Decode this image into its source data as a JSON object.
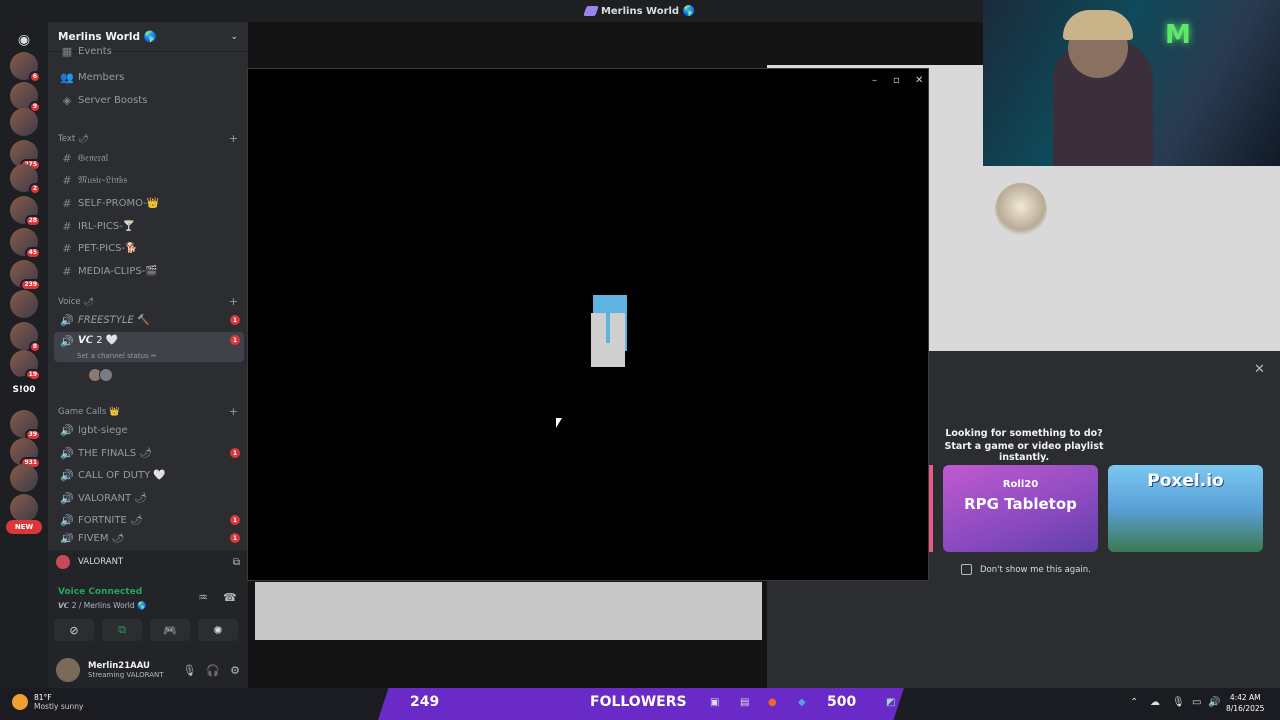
{
  "window": {
    "title": "Merlins World 🌎"
  },
  "servers": {
    "badges": [
      "6",
      "9",
      "",
      "275",
      "2",
      "28",
      "45",
      "239",
      "",
      "8",
      "19",
      "",
      "39",
      "931",
      "",
      ""
    ],
    "new_label": "NEW",
    "s100_label": "S!00"
  },
  "server": {
    "name": "Merlins World 🌎",
    "top_items": [
      {
        "icon": "calendar-icon",
        "label": "Events"
      },
      {
        "icon": "members-icon",
        "label": "Members"
      },
      {
        "icon": "boost-icon",
        "label": "Server Boosts"
      }
    ],
    "categories": {
      "text": "Text 🌶",
      "voice": "Voice 🌶",
      "game": "Game Calls 👑"
    },
    "text_channels": [
      "𝔊𝔢𝔫𝔢𝔯𝔞𝔩",
      "𝔐𝔲𝔰𝔦𝔠-𝔏𝔦𝔫𝔨𝔰",
      "SELF-PROMO-👑",
      "IRL-PICS-🍸",
      "PET-PICS-🐕",
      "MEDIA-CLIPS-🎬"
    ],
    "voice_channels": [
      {
        "label": "𝘍𝘙𝘌𝘌𝘚𝘛𝘠𝘓𝘌 🔨",
        "pill": "1"
      },
      {
        "label": "𝙑𝘾 2 🤍",
        "pill": "1"
      }
    ],
    "channel_status": "Set a channel status ✏",
    "game_channels": [
      {
        "label": "lgbt-siege",
        "pill": ""
      },
      {
        "label": "THE FINALS 🌶",
        "pill": "1"
      },
      {
        "label": "CALL OF DUTY 🤍",
        "pill": ""
      },
      {
        "label": "VALORANT 🌶",
        "pill": ""
      },
      {
        "label": "FORTNITE 🌶",
        "pill": "1"
      },
      {
        "label": "FIVEM 🌶",
        "pill": "1"
      }
    ]
  },
  "activity": {
    "label": "VALORANT"
  },
  "voice": {
    "status": "Voice Connected",
    "location": "𝙑𝘾 2 / Merlins World 🌎"
  },
  "user": {
    "name": "Merlin21AAU",
    "status": "Streaming VALORANT"
  },
  "popup": {
    "minimize": "–",
    "maximize": "▫",
    "close": "✕"
  },
  "activities": {
    "close": "✕",
    "title": "Looking for something to do?",
    "subtitle": "Start a game or video playlist instantly.",
    "card1_top": "Roll20",
    "card1_title": "RPG Tabletop",
    "card2_title": "Poxel.io",
    "dont_show": "Don't show me this again."
  },
  "taskbar": {
    "temp": "81°F",
    "weather": "Mostly sunny",
    "count_left": "249",
    "followers_label": "FOLLOWERS",
    "count_right": "500",
    "time": "4:42 AM",
    "date": "8/16/2025"
  }
}
